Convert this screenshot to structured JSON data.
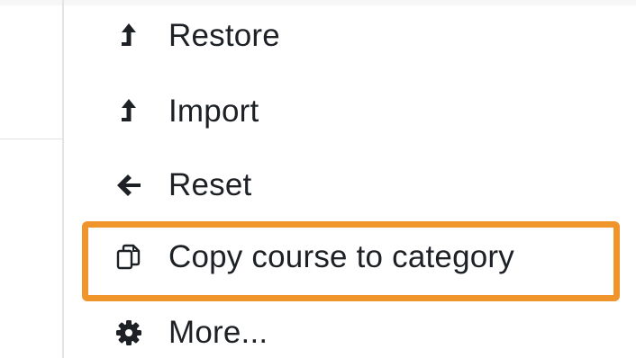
{
  "menu": {
    "items": [
      {
        "label": "Restore",
        "icon": "upload-arrow-icon"
      },
      {
        "label": "Import",
        "icon": "upload-arrow-icon"
      },
      {
        "label": "Reset",
        "icon": "arrow-left-icon"
      },
      {
        "label": "Copy course to category",
        "icon": "copy-icon",
        "highlighted": true
      },
      {
        "label": "More...",
        "icon": "gear-icon"
      }
    ]
  },
  "colors": {
    "text": "#1d2125",
    "highlight_border": "#f0952c",
    "divider": "#e4e4e4"
  }
}
